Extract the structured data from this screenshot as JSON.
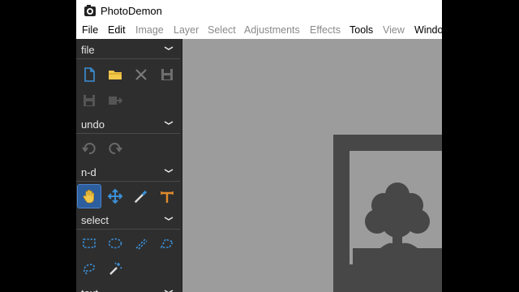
{
  "window": {
    "title": "PhotoDemon"
  },
  "menu": {
    "items": [
      {
        "id": "file",
        "label": "File",
        "enabled": true
      },
      {
        "id": "edit",
        "label": "Edit",
        "enabled": true
      },
      {
        "id": "image",
        "label": "Image",
        "enabled": false
      },
      {
        "id": "layer",
        "label": "Layer",
        "enabled": false
      },
      {
        "id": "select",
        "label": "Select",
        "enabled": false
      },
      {
        "id": "adjustments",
        "label": "Adjustments",
        "enabled": false
      },
      {
        "id": "effects",
        "label": "Effects",
        "enabled": false
      },
      {
        "id": "tools",
        "label": "Tools",
        "enabled": true
      },
      {
        "id": "view",
        "label": "View",
        "enabled": false
      },
      {
        "id": "window",
        "label": "Windo",
        "enabled": true
      }
    ]
  },
  "toolbox": {
    "sections": [
      {
        "id": "file",
        "label": "file",
        "tools": [
          "new-file-icon",
          "open-folder-icon",
          "close-icon",
          "save-icon",
          "save-as-icon",
          "export-icon"
        ]
      },
      {
        "id": "undo",
        "label": "undo",
        "tools": [
          "undo-icon",
          "redo-icon"
        ]
      },
      {
        "id": "nd",
        "label": "n-d",
        "tools": [
          "hand-icon",
          "move-icon",
          "color-picker-icon",
          "measure-icon"
        ],
        "active": "hand-icon"
      },
      {
        "id": "select",
        "label": "select",
        "tools": [
          "rect-select-icon",
          "ellipse-select-icon",
          "line-select-icon",
          "polygon-select-icon",
          "lasso-select-icon",
          "magic-wand-icon"
        ]
      },
      {
        "id": "text",
        "label": "text",
        "tools": []
      }
    ]
  },
  "colors": {
    "canvas": "#9c9c9c",
    "toolbox": "#2e2e2e",
    "active_tool": "#2d5e9e",
    "icon_blue": "#3b8fd6",
    "icon_yellow": "#f2c84b",
    "icon_orange": "#e08a2c"
  }
}
